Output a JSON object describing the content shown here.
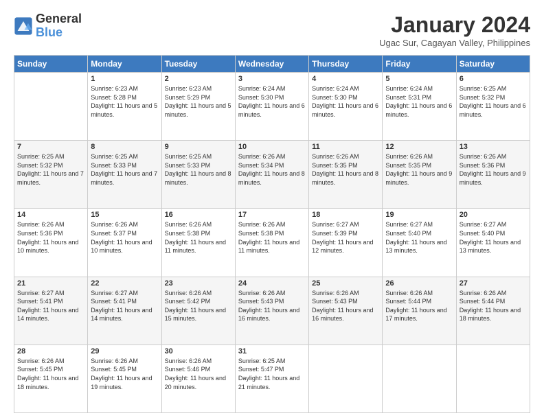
{
  "logo": {
    "line1": "General",
    "line2": "Blue"
  },
  "title": "January 2024",
  "location": "Ugac Sur, Cagayan Valley, Philippines",
  "days_header": [
    "Sunday",
    "Monday",
    "Tuesday",
    "Wednesday",
    "Thursday",
    "Friday",
    "Saturday"
  ],
  "weeks": [
    [
      {
        "day": "",
        "sunrise": "",
        "sunset": "",
        "daylight": ""
      },
      {
        "day": "1",
        "sunrise": "Sunrise: 6:23 AM",
        "sunset": "Sunset: 5:28 PM",
        "daylight": "Daylight: 11 hours and 5 minutes."
      },
      {
        "day": "2",
        "sunrise": "Sunrise: 6:23 AM",
        "sunset": "Sunset: 5:29 PM",
        "daylight": "Daylight: 11 hours and 5 minutes."
      },
      {
        "day": "3",
        "sunrise": "Sunrise: 6:24 AM",
        "sunset": "Sunset: 5:30 PM",
        "daylight": "Daylight: 11 hours and 6 minutes."
      },
      {
        "day": "4",
        "sunrise": "Sunrise: 6:24 AM",
        "sunset": "Sunset: 5:30 PM",
        "daylight": "Daylight: 11 hours and 6 minutes."
      },
      {
        "day": "5",
        "sunrise": "Sunrise: 6:24 AM",
        "sunset": "Sunset: 5:31 PM",
        "daylight": "Daylight: 11 hours and 6 minutes."
      },
      {
        "day": "6",
        "sunrise": "Sunrise: 6:25 AM",
        "sunset": "Sunset: 5:32 PM",
        "daylight": "Daylight: 11 hours and 6 minutes."
      }
    ],
    [
      {
        "day": "7",
        "sunrise": "Sunrise: 6:25 AM",
        "sunset": "Sunset: 5:32 PM",
        "daylight": "Daylight: 11 hours and 7 minutes."
      },
      {
        "day": "8",
        "sunrise": "Sunrise: 6:25 AM",
        "sunset": "Sunset: 5:33 PM",
        "daylight": "Daylight: 11 hours and 7 minutes."
      },
      {
        "day": "9",
        "sunrise": "Sunrise: 6:25 AM",
        "sunset": "Sunset: 5:33 PM",
        "daylight": "Daylight: 11 hours and 8 minutes."
      },
      {
        "day": "10",
        "sunrise": "Sunrise: 6:26 AM",
        "sunset": "Sunset: 5:34 PM",
        "daylight": "Daylight: 11 hours and 8 minutes."
      },
      {
        "day": "11",
        "sunrise": "Sunrise: 6:26 AM",
        "sunset": "Sunset: 5:35 PM",
        "daylight": "Daylight: 11 hours and 8 minutes."
      },
      {
        "day": "12",
        "sunrise": "Sunrise: 6:26 AM",
        "sunset": "Sunset: 5:35 PM",
        "daylight": "Daylight: 11 hours and 9 minutes."
      },
      {
        "day": "13",
        "sunrise": "Sunrise: 6:26 AM",
        "sunset": "Sunset: 5:36 PM",
        "daylight": "Daylight: 11 hours and 9 minutes."
      }
    ],
    [
      {
        "day": "14",
        "sunrise": "Sunrise: 6:26 AM",
        "sunset": "Sunset: 5:36 PM",
        "daylight": "Daylight: 11 hours and 10 minutes."
      },
      {
        "day": "15",
        "sunrise": "Sunrise: 6:26 AM",
        "sunset": "Sunset: 5:37 PM",
        "daylight": "Daylight: 11 hours and 10 minutes."
      },
      {
        "day": "16",
        "sunrise": "Sunrise: 6:26 AM",
        "sunset": "Sunset: 5:38 PM",
        "daylight": "Daylight: 11 hours and 11 minutes."
      },
      {
        "day": "17",
        "sunrise": "Sunrise: 6:26 AM",
        "sunset": "Sunset: 5:38 PM",
        "daylight": "Daylight: 11 hours and 11 minutes."
      },
      {
        "day": "18",
        "sunrise": "Sunrise: 6:27 AM",
        "sunset": "Sunset: 5:39 PM",
        "daylight": "Daylight: 11 hours and 12 minutes."
      },
      {
        "day": "19",
        "sunrise": "Sunrise: 6:27 AM",
        "sunset": "Sunset: 5:40 PM",
        "daylight": "Daylight: 11 hours and 13 minutes."
      },
      {
        "day": "20",
        "sunrise": "Sunrise: 6:27 AM",
        "sunset": "Sunset: 5:40 PM",
        "daylight": "Daylight: 11 hours and 13 minutes."
      }
    ],
    [
      {
        "day": "21",
        "sunrise": "Sunrise: 6:27 AM",
        "sunset": "Sunset: 5:41 PM",
        "daylight": "Daylight: 11 hours and 14 minutes."
      },
      {
        "day": "22",
        "sunrise": "Sunrise: 6:27 AM",
        "sunset": "Sunset: 5:41 PM",
        "daylight": "Daylight: 11 hours and 14 minutes."
      },
      {
        "day": "23",
        "sunrise": "Sunrise: 6:26 AM",
        "sunset": "Sunset: 5:42 PM",
        "daylight": "Daylight: 11 hours and 15 minutes."
      },
      {
        "day": "24",
        "sunrise": "Sunrise: 6:26 AM",
        "sunset": "Sunset: 5:43 PM",
        "daylight": "Daylight: 11 hours and 16 minutes."
      },
      {
        "day": "25",
        "sunrise": "Sunrise: 6:26 AM",
        "sunset": "Sunset: 5:43 PM",
        "daylight": "Daylight: 11 hours and 16 minutes."
      },
      {
        "day": "26",
        "sunrise": "Sunrise: 6:26 AM",
        "sunset": "Sunset: 5:44 PM",
        "daylight": "Daylight: 11 hours and 17 minutes."
      },
      {
        "day": "27",
        "sunrise": "Sunrise: 6:26 AM",
        "sunset": "Sunset: 5:44 PM",
        "daylight": "Daylight: 11 hours and 18 minutes."
      }
    ],
    [
      {
        "day": "28",
        "sunrise": "Sunrise: 6:26 AM",
        "sunset": "Sunset: 5:45 PM",
        "daylight": "Daylight: 11 hours and 18 minutes."
      },
      {
        "day": "29",
        "sunrise": "Sunrise: 6:26 AM",
        "sunset": "Sunset: 5:45 PM",
        "daylight": "Daylight: 11 hours and 19 minutes."
      },
      {
        "day": "30",
        "sunrise": "Sunrise: 6:26 AM",
        "sunset": "Sunset: 5:46 PM",
        "daylight": "Daylight: 11 hours and 20 minutes."
      },
      {
        "day": "31",
        "sunrise": "Sunrise: 6:25 AM",
        "sunset": "Sunset: 5:47 PM",
        "daylight": "Daylight: 11 hours and 21 minutes."
      },
      {
        "day": "",
        "sunrise": "",
        "sunset": "",
        "daylight": ""
      },
      {
        "day": "",
        "sunrise": "",
        "sunset": "",
        "daylight": ""
      },
      {
        "day": "",
        "sunrise": "",
        "sunset": "",
        "daylight": ""
      }
    ]
  ]
}
